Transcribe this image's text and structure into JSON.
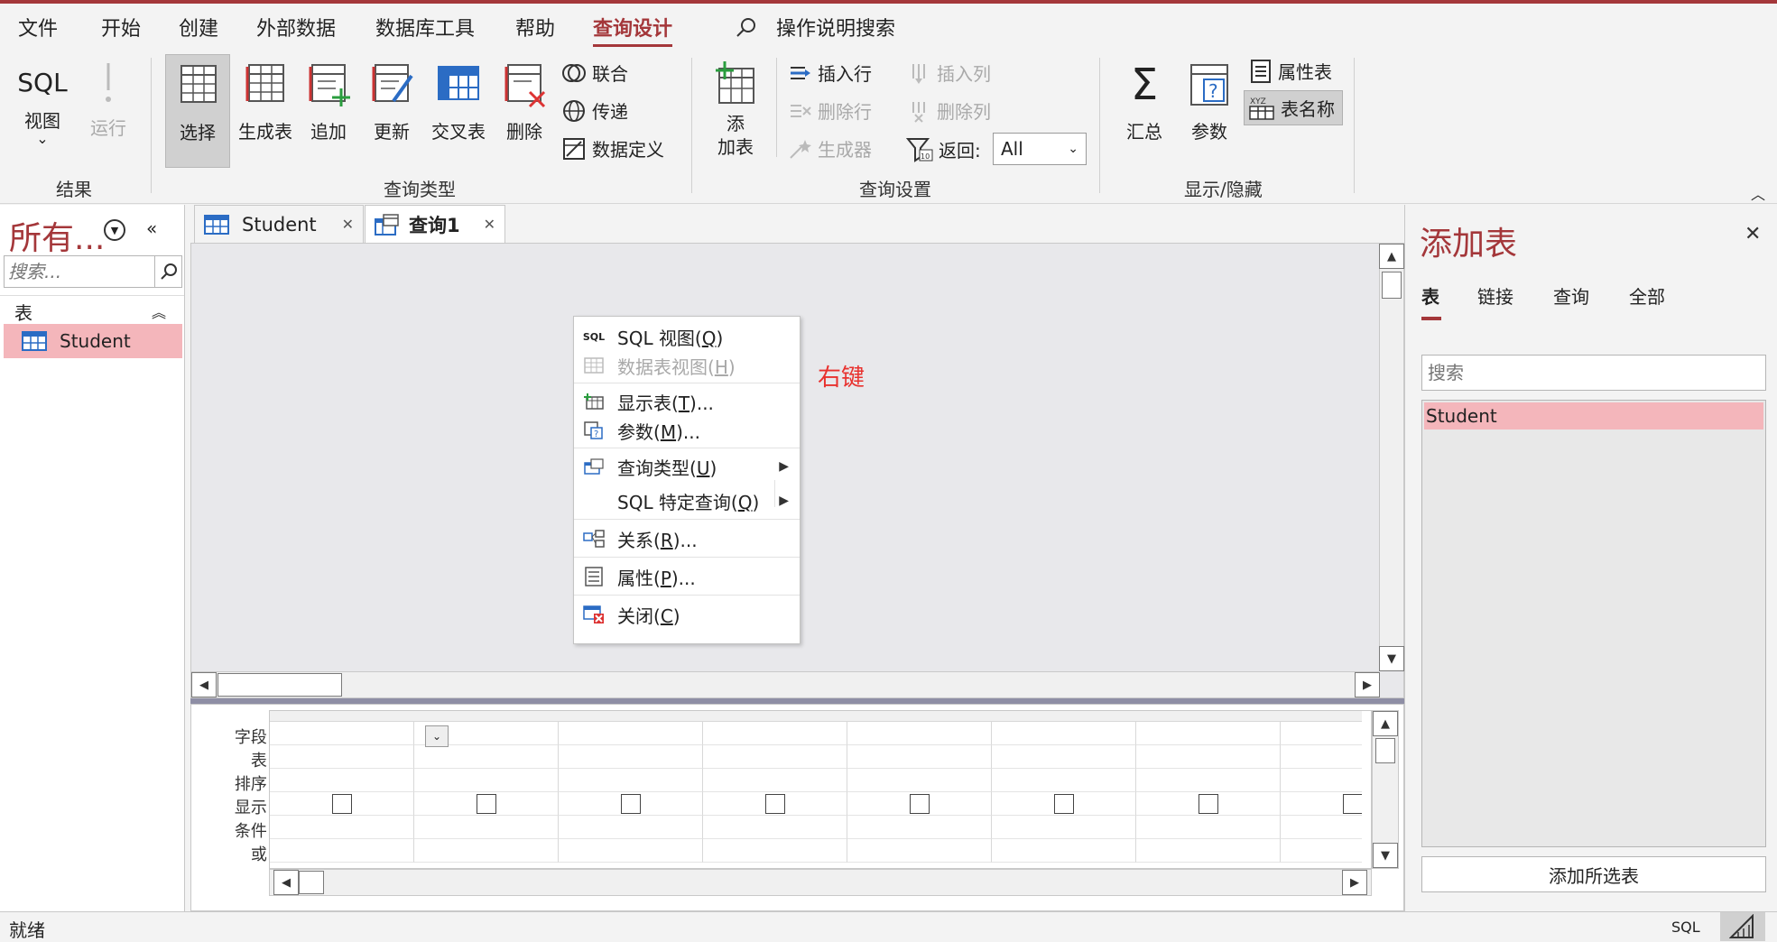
{
  "ribbon_tabs": [
    "文件",
    "开始",
    "创建",
    "外部数据",
    "数据库工具",
    "帮助",
    "查询设计"
  ],
  "active_tab": "查询设计",
  "search_label": "操作说明搜索",
  "ribbon": {
    "sql_view": {
      "top": "SQL",
      "label": "视图",
      "sub": "⌄"
    },
    "run": "运行",
    "group_results": "结果",
    "query_types": [
      "选择",
      "生成表",
      "追加",
      "更新",
      "交叉表",
      "删除"
    ],
    "union": "联合",
    "passthrough": "传递",
    "data_definition": "数据定义",
    "group_query_type": "查询类型",
    "add_table": "添\n加表",
    "add_table_line1": "添",
    "add_table_line2": "加表",
    "insert_row": "插入行",
    "delete_row": "删除行",
    "builder": "生成器",
    "insert_col": "插入列",
    "delete_col": "删除列",
    "return_label": "返回:",
    "return_value": "All",
    "group_query_setup": "查询设置",
    "totals": "汇总",
    "parameters": "参数",
    "property_sheet": "属性表",
    "table_names": "表名称",
    "table_names_icon_text": "XYZ",
    "group_showhide": "显示/隐藏"
  },
  "nav": {
    "title": "所有...",
    "search_placeholder": "搜索...",
    "section": "表",
    "items": [
      "Student"
    ]
  },
  "doc_tabs": [
    {
      "label": "Student"
    },
    {
      "label": "查询1"
    }
  ],
  "context_menu": [
    {
      "label": "SQL 视图(",
      "key": "Q",
      "tail": ")",
      "icon": "SQL",
      "disabled": false
    },
    {
      "label": "数据表视图(",
      "key": "H",
      "tail": ")",
      "disabled": true
    },
    {
      "label": "显示表(",
      "key": "T",
      "tail": ")...",
      "disabled": false
    },
    {
      "label": "参数(",
      "key": "M",
      "tail": ")...",
      "disabled": false
    },
    {
      "label": "查询类型(",
      "key": "U",
      "tail": ")",
      "disabled": false,
      "submenu": true
    },
    {
      "label": "SQL 特定查询(",
      "key": "Q",
      "tail": ")",
      "disabled": false,
      "submenu": true
    },
    {
      "label": "关系(",
      "key": "R",
      "tail": ")...",
      "disabled": false
    },
    {
      "label": "属性(",
      "key": "P",
      "tail": ")...",
      "disabled": false
    },
    {
      "label": "关闭(",
      "key": "C",
      "tail": ")",
      "disabled": false
    }
  ],
  "annotation": "右键",
  "grid_labels": [
    "字段:",
    "表:",
    "排序:",
    "显示:",
    "条件:",
    "或:"
  ],
  "add_table_pane": {
    "title": "添加表",
    "tabs": [
      "表",
      "链接",
      "查询",
      "全部"
    ],
    "search_placeholder": "搜索",
    "items": [
      "Student"
    ],
    "button": "添加所选表"
  },
  "status": {
    "left": "就绪",
    "right": "SQL"
  },
  "colors": {
    "accent": "#a4373a",
    "selection": "#f4b6bb",
    "annotation": "#e8312e"
  }
}
